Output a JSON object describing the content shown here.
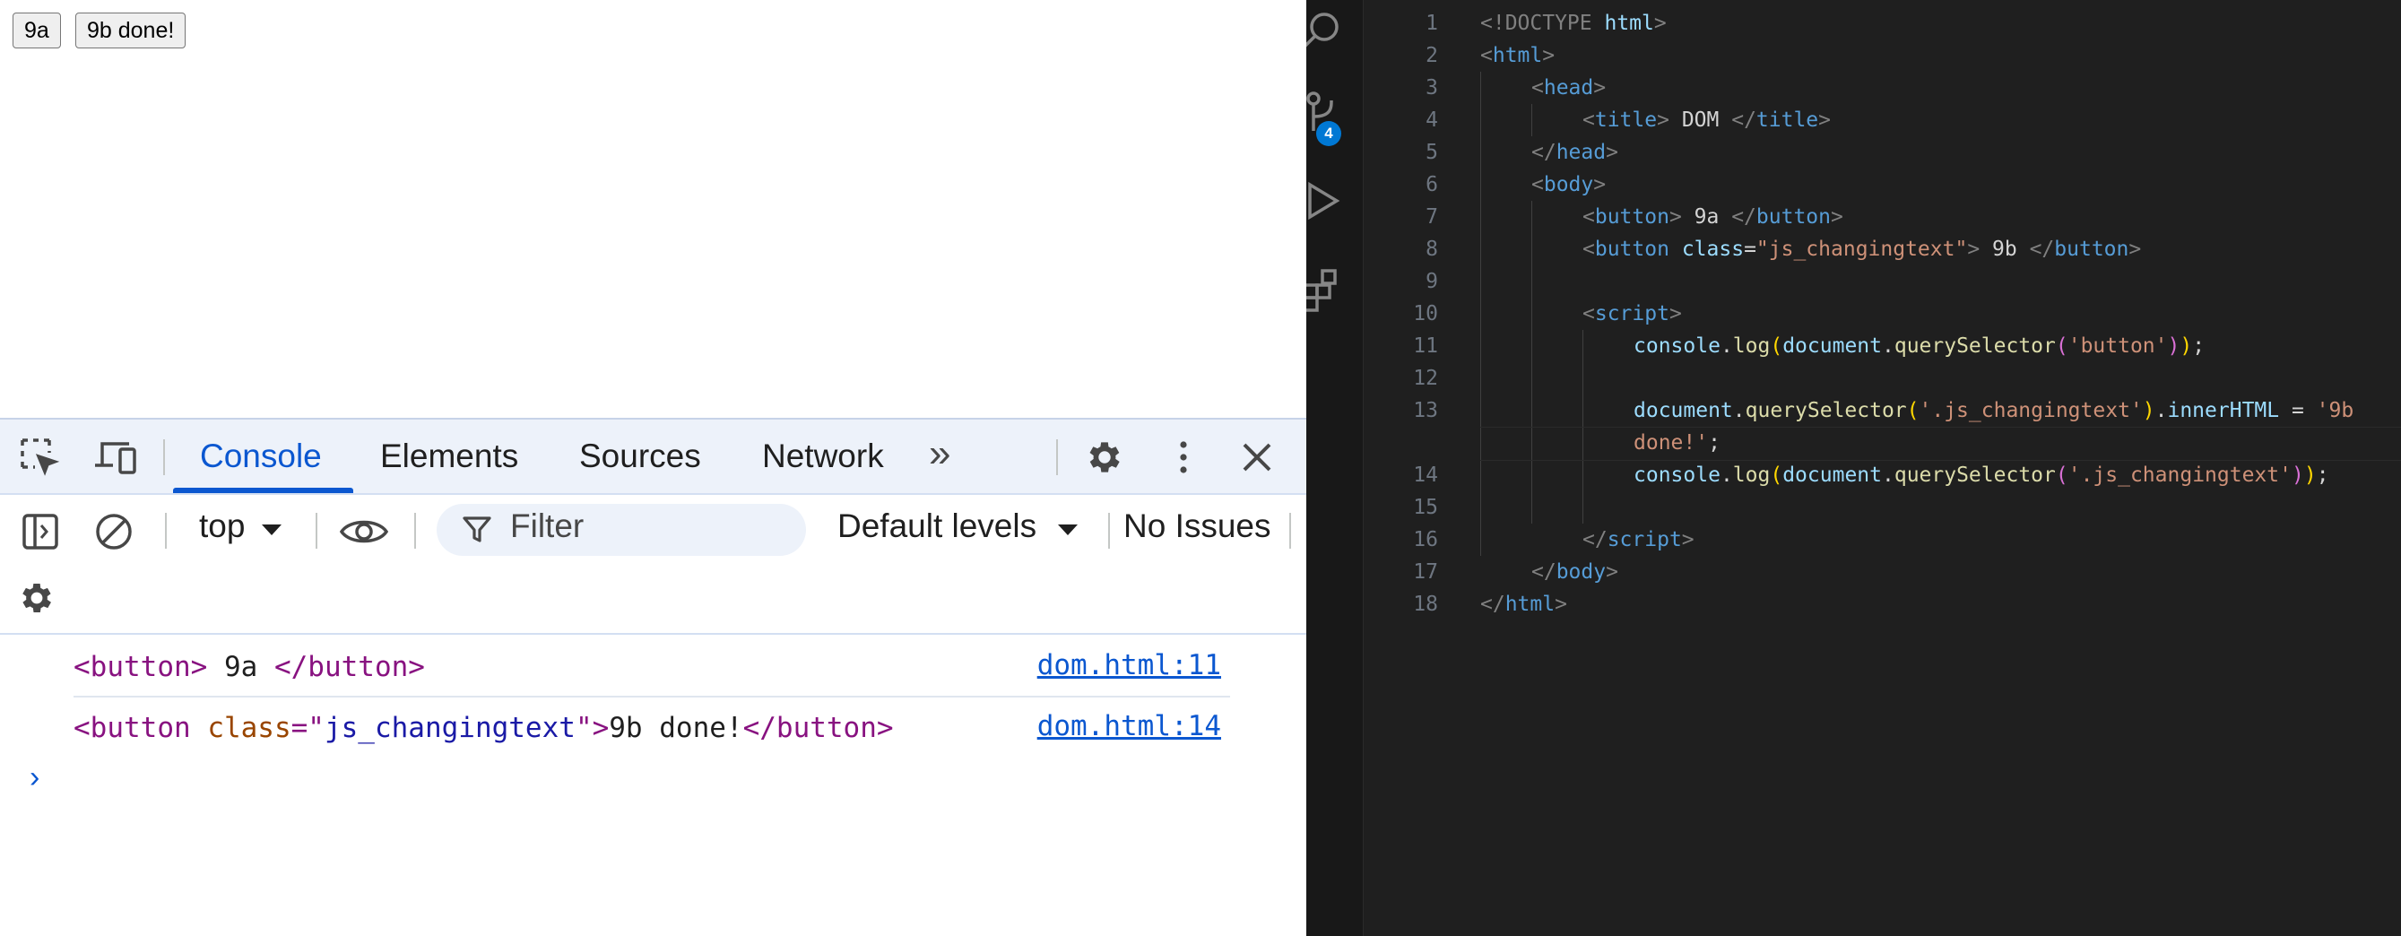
{
  "page": {
    "buttons": [
      {
        "label": "9a"
      },
      {
        "label": "9b done!"
      }
    ]
  },
  "devtools": {
    "tabs": [
      {
        "label": "Console",
        "active": true
      },
      {
        "label": "Elements",
        "active": false
      },
      {
        "label": "Sources",
        "active": false
      },
      {
        "label": "Network",
        "active": false
      }
    ],
    "overflow_glyph": "»",
    "context": "top",
    "filter_placeholder": "Filter",
    "levels": "Default levels",
    "issues": "No Issues",
    "messages": [
      {
        "parts": [
          {
            "text": "<button>",
            "kind": "tag"
          },
          {
            "text": " 9a ",
            "kind": "plain"
          },
          {
            "text": "</button>",
            "kind": "tag"
          }
        ],
        "source": "dom.html:11"
      },
      {
        "parts": [
          {
            "text": "<button ",
            "kind": "tag"
          },
          {
            "text": "class",
            "kind": "attr"
          },
          {
            "text": "=\"",
            "kind": "tag"
          },
          {
            "text": "js_changingtext",
            "kind": "attrval"
          },
          {
            "text": "\">",
            "kind": "tag"
          },
          {
            "text": "9b done!",
            "kind": "plain"
          },
          {
            "text": "</button>",
            "kind": "tag"
          }
        ],
        "source": "dom.html:14"
      }
    ],
    "prompt_glyph": "›"
  },
  "editor": {
    "scm_badge": "4",
    "lines": [
      {
        "n": "1",
        "indent": 0,
        "tokens": [
          [
            "<!DOCTYPE ",
            "t-br"
          ],
          [
            "html",
            "t-attr"
          ],
          [
            ">",
            "t-br"
          ]
        ]
      },
      {
        "n": "2",
        "indent": 0,
        "tokens": [
          [
            "<",
            "t-br"
          ],
          [
            "html",
            "t-tag"
          ],
          [
            ">",
            "t-br"
          ]
        ]
      },
      {
        "n": "3",
        "indent": 1,
        "tokens": [
          [
            "<",
            "t-br"
          ],
          [
            "head",
            "t-tag"
          ],
          [
            ">",
            "t-br"
          ]
        ]
      },
      {
        "n": "4",
        "indent": 2,
        "tokens": [
          [
            "<",
            "t-br"
          ],
          [
            "title",
            "t-tag"
          ],
          [
            ">",
            "t-br"
          ],
          [
            " DOM ",
            "t-plain"
          ],
          [
            "</",
            "t-br"
          ],
          [
            "title",
            "t-tag"
          ],
          [
            ">",
            "t-br"
          ]
        ]
      },
      {
        "n": "5",
        "indent": 1,
        "tokens": [
          [
            "</",
            "t-br"
          ],
          [
            "head",
            "t-tag"
          ],
          [
            ">",
            "t-br"
          ]
        ]
      },
      {
        "n": "6",
        "indent": 1,
        "tokens": [
          [
            "<",
            "t-br"
          ],
          [
            "body",
            "t-tag"
          ],
          [
            ">",
            "t-br"
          ]
        ]
      },
      {
        "n": "7",
        "indent": 2,
        "tokens": [
          [
            "<",
            "t-br"
          ],
          [
            "button",
            "t-tag"
          ],
          [
            ">",
            "t-br"
          ],
          [
            " 9a ",
            "t-plain"
          ],
          [
            "</",
            "t-br"
          ],
          [
            "button",
            "t-tag"
          ],
          [
            ">",
            "t-br"
          ]
        ]
      },
      {
        "n": "8",
        "indent": 2,
        "tokens": [
          [
            "<",
            "t-br"
          ],
          [
            "button",
            "t-tag"
          ],
          [
            " ",
            "t-plain"
          ],
          [
            "class",
            "t-attr"
          ],
          [
            "=",
            "t-plain"
          ],
          [
            "\"js_changingtext\"",
            "t-str"
          ],
          [
            ">",
            "t-br"
          ],
          [
            " 9b ",
            "t-plain"
          ],
          [
            "</",
            "t-br"
          ],
          [
            "button",
            "t-tag"
          ],
          [
            ">",
            "t-br"
          ]
        ]
      },
      {
        "n": "9",
        "indent": 0,
        "tokens": []
      },
      {
        "n": "10",
        "indent": 2,
        "tokens": [
          [
            "<",
            "t-br"
          ],
          [
            "script",
            "t-tag"
          ],
          [
            ">",
            "t-br"
          ]
        ]
      },
      {
        "n": "11",
        "indent": 3,
        "tokens": [
          [
            "console",
            "t-var"
          ],
          [
            ".",
            "t-plain"
          ],
          [
            "log",
            "t-fn"
          ],
          [
            "(",
            "t-paren"
          ],
          [
            "document",
            "t-var"
          ],
          [
            ".",
            "t-plain"
          ],
          [
            "querySelector",
            "t-fn"
          ],
          [
            "(",
            "t-paren2"
          ],
          [
            "'button'",
            "t-str"
          ],
          [
            ")",
            "t-paren2"
          ],
          [
            ")",
            "t-paren"
          ],
          [
            ";",
            "t-plain"
          ]
        ]
      },
      {
        "n": "12",
        "indent": 0,
        "tokens": []
      },
      {
        "n": "13",
        "indent": 3,
        "tokens": [
          [
            "document",
            "t-var"
          ],
          [
            ".",
            "t-plain"
          ],
          [
            "querySelector",
            "t-fn"
          ],
          [
            "(",
            "t-paren"
          ],
          [
            "'.js_changingtext'",
            "t-str"
          ],
          [
            ")",
            "t-paren"
          ],
          [
            ".",
            "t-plain"
          ],
          [
            "innerHTML",
            "t-var"
          ],
          [
            " = ",
            "t-plain"
          ],
          [
            "'9b",
            "t-str"
          ]
        ]
      },
      {
        "n": "",
        "indent": 3,
        "tokens": [
          [
            "done!'",
            "t-str"
          ],
          [
            ";",
            "t-plain"
          ]
        ]
      },
      {
        "n": "14",
        "indent": 3,
        "tokens": [
          [
            "console",
            "t-var"
          ],
          [
            ".",
            "t-plain"
          ],
          [
            "log",
            "t-fn"
          ],
          [
            "(",
            "t-paren"
          ],
          [
            "document",
            "t-var"
          ],
          [
            ".",
            "t-plain"
          ],
          [
            "querySelector",
            "t-fn"
          ],
          [
            "(",
            "t-paren2"
          ],
          [
            "'.js_changingtext'",
            "t-str"
          ],
          [
            ")",
            "t-paren2"
          ],
          [
            ")",
            "t-paren"
          ],
          [
            ";",
            "t-plain"
          ]
        ]
      },
      {
        "n": "15",
        "indent": 0,
        "tokens": []
      },
      {
        "n": "16",
        "indent": 2,
        "tokens": [
          [
            "</",
            "t-br"
          ],
          [
            "script",
            "t-tag"
          ],
          [
            ">",
            "t-br"
          ]
        ]
      },
      {
        "n": "17",
        "indent": 1,
        "tokens": [
          [
            "</",
            "t-br"
          ],
          [
            "body",
            "t-tag"
          ],
          [
            ">",
            "t-br"
          ]
        ]
      },
      {
        "n": "18",
        "indent": 0,
        "tokens": [
          [
            "</",
            "t-br"
          ],
          [
            "html",
            "t-tag"
          ],
          [
            ">",
            "t-br"
          ]
        ]
      }
    ]
  }
}
